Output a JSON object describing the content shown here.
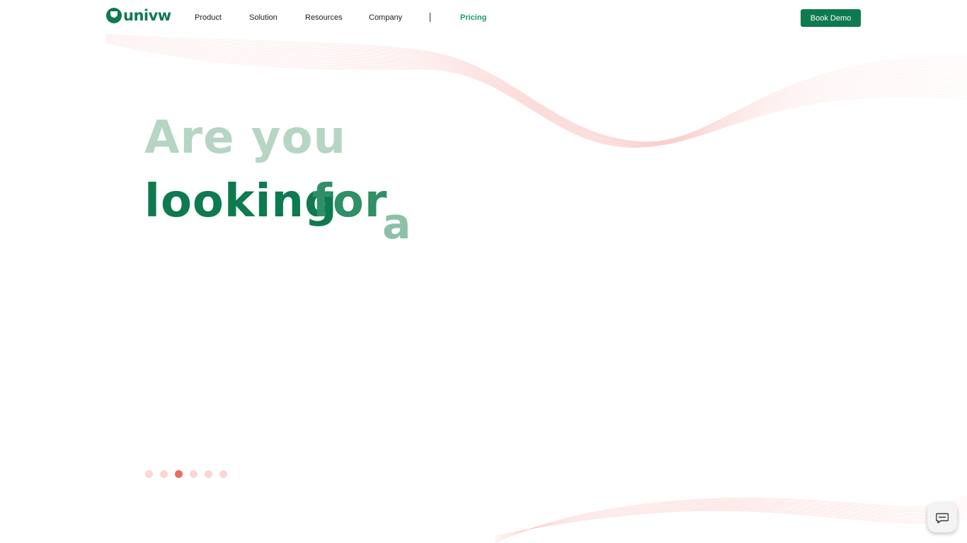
{
  "brand": {
    "name": "univw",
    "color": "#0e7a4f",
    "accent": "#1a9b64"
  },
  "nav": {
    "items": [
      {
        "label": "Product"
      },
      {
        "label": "Solution"
      },
      {
        "label": "Resources"
      },
      {
        "label": "Company"
      },
      {
        "label": "Pricing"
      }
    ],
    "cta_label": "Book Demo"
  },
  "hero": {
    "line1": "Are you",
    "line2_word1": "looking",
    "line2_word2": "for",
    "line2_word3": "a"
  },
  "carousel": {
    "total_dots": 6,
    "active_index": 2,
    "dot_color": "#fbd6d3",
    "active_color": "#e76f62"
  },
  "chat": {
    "icon": "chat-icon"
  }
}
